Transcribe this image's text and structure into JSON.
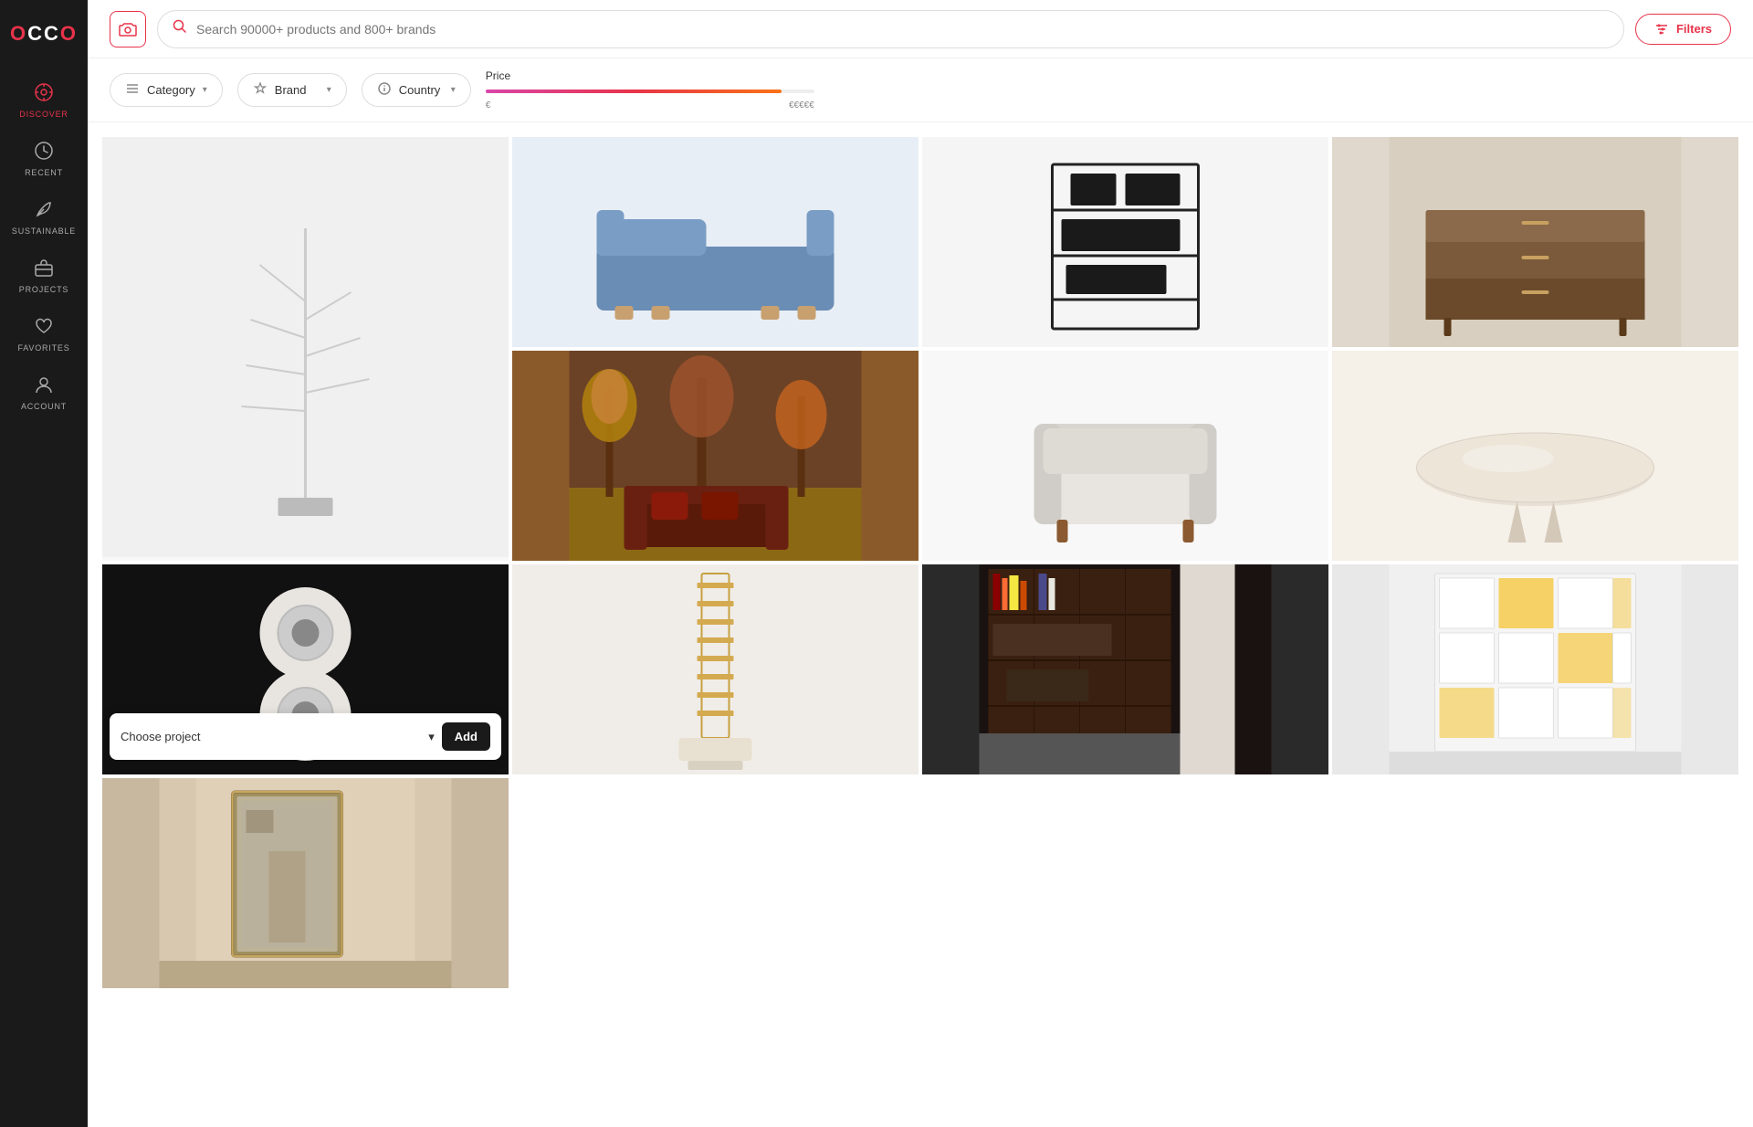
{
  "sidebar": {
    "logo": "OCCO",
    "items": [
      {
        "id": "discover",
        "label": "DISCOVER",
        "icon": "⊙",
        "active": true
      },
      {
        "id": "recent",
        "label": "RECENT",
        "icon": "🕐",
        "active": false
      },
      {
        "id": "sustainable",
        "label": "SUSTAINABLE",
        "icon": "🌿",
        "active": false
      },
      {
        "id": "projects",
        "label": "PROJECTS",
        "icon": "💼",
        "active": false
      },
      {
        "id": "favorites",
        "label": "FAVORITES",
        "icon": "♡",
        "active": false
      },
      {
        "id": "account",
        "label": "ACCOUNT",
        "icon": "👤",
        "active": false
      }
    ]
  },
  "topbar": {
    "camera_label": "📷",
    "search_placeholder": "Search 90000+ products and 800+ brands",
    "filters_label": "Filters",
    "filters_icon": "⚙"
  },
  "filterbar": {
    "category": {
      "label": "Category",
      "icon": "≡"
    },
    "brand": {
      "label": "Brand",
      "icon": "★"
    },
    "country": {
      "label": "Country",
      "icon": "ℹ"
    },
    "price": {
      "label": "Price",
      "min": "€",
      "max": "€€€€€"
    }
  },
  "choose_project": {
    "placeholder": "Choose project",
    "add_label": "Add"
  },
  "products": [
    {
      "id": 1,
      "bg": "#f0f0f0",
      "tall": true,
      "emoji": ""
    },
    {
      "id": 2,
      "bg": "#e8eef5",
      "tall": false,
      "emoji": ""
    },
    {
      "id": 3,
      "bg": "#f5f5f5",
      "tall": false,
      "emoji": ""
    },
    {
      "id": 4,
      "bg": "#e8e4dc",
      "tall": false,
      "emoji": ""
    },
    {
      "id": 5,
      "bg": "#7a5c3a",
      "tall": false,
      "emoji": ""
    },
    {
      "id": 6,
      "bg": "#f8f8f8",
      "tall": false,
      "emoji": ""
    },
    {
      "id": 7,
      "bg": "#f5f0e8",
      "tall": false,
      "emoji": ""
    },
    {
      "id": 8,
      "bg": "#111111",
      "tall": false,
      "emoji": ""
    },
    {
      "id": 9,
      "bg": "#f0ede8",
      "tall": false,
      "emoji": ""
    },
    {
      "id": 10,
      "bg": "#2a2a2a",
      "tall": false,
      "emoji": ""
    },
    {
      "id": 11,
      "bg": "#e8e8e8",
      "tall": false,
      "emoji": ""
    },
    {
      "id": 12,
      "bg": "#c8b8a0",
      "tall": false,
      "emoji": ""
    }
  ]
}
